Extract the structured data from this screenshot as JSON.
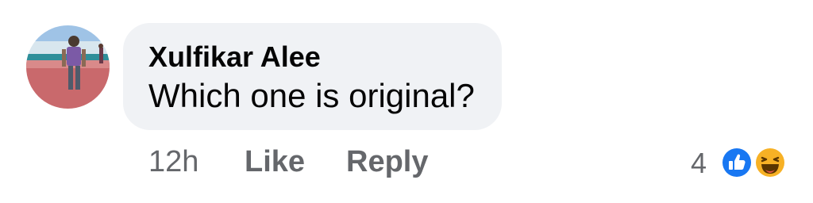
{
  "comment": {
    "author": "Xulfikar Alee",
    "text": "Which one is original?",
    "timestamp": "12h",
    "like_label": "Like",
    "reply_label": "Reply",
    "reaction_count": "4",
    "reactions": [
      "like-icon",
      "haha-icon"
    ]
  },
  "colors": {
    "bubble_bg": "#f0f2f5",
    "text": "#050505",
    "secondary_text": "#65676b",
    "like_blue": "#1877f2",
    "haha_yellow": "#f7b125"
  }
}
